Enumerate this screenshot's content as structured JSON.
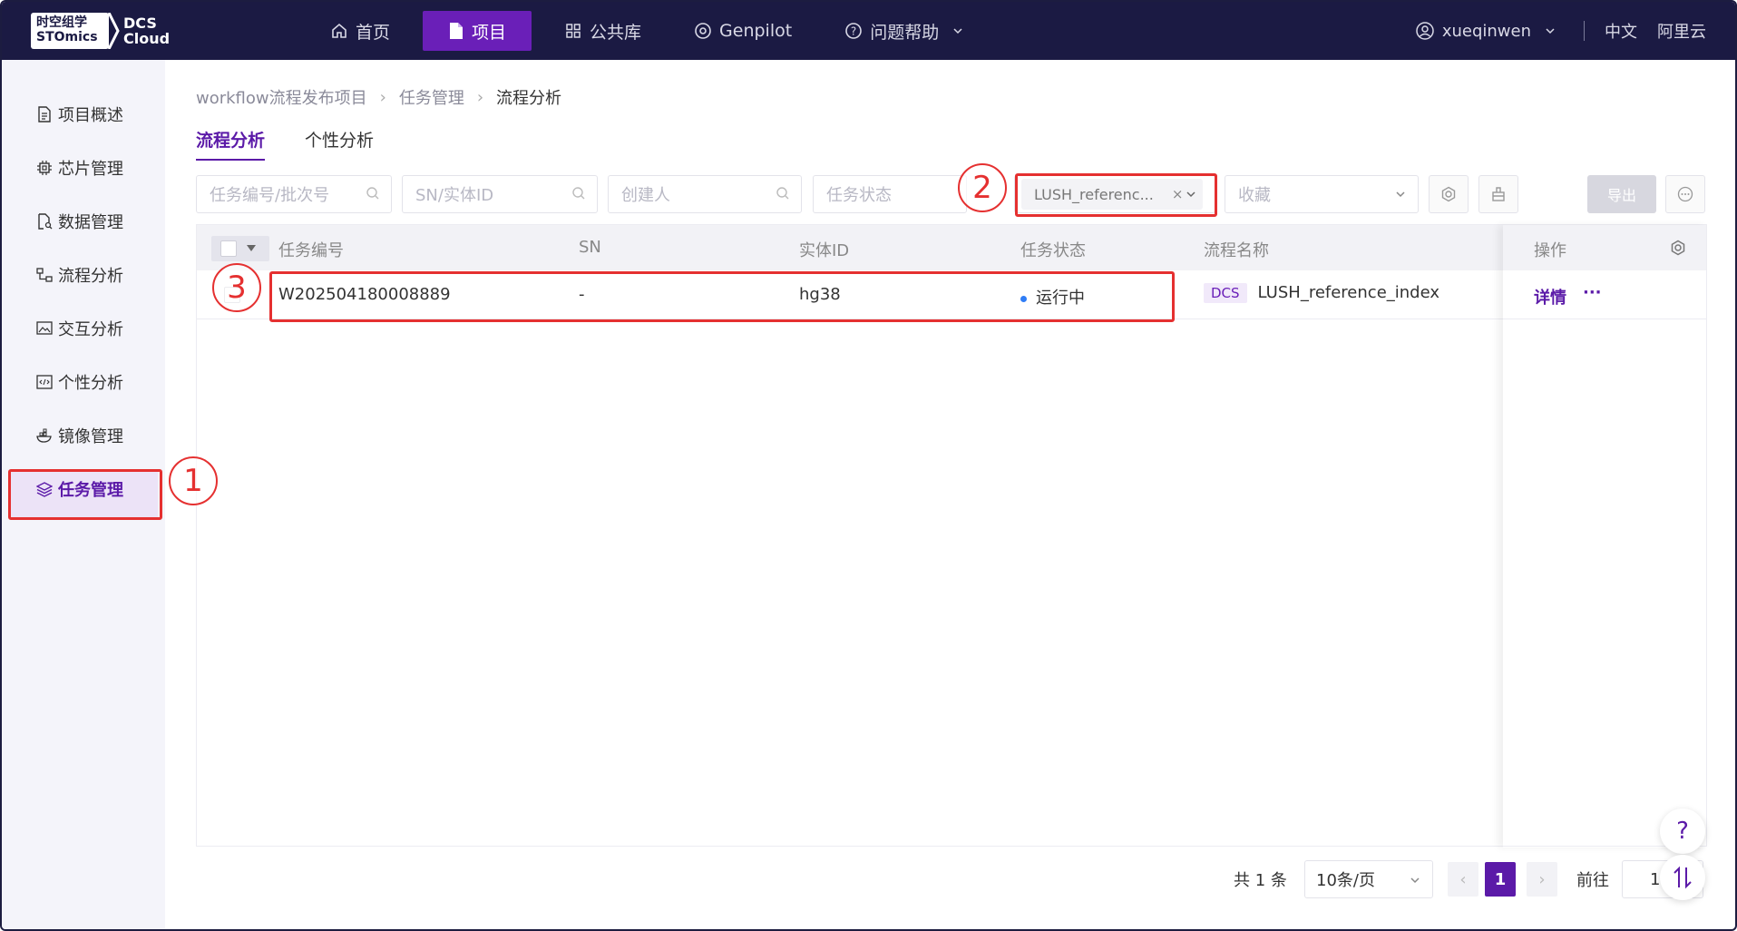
{
  "logo": {
    "brand_line1": "时空组学",
    "brand_line2": "STOmics",
    "product_line1": "DCS",
    "product_line2": "Cloud"
  },
  "nav": {
    "home": "首页",
    "project": "项目",
    "library": "公共库",
    "genpilot": "Genpilot",
    "help": "问题帮助"
  },
  "user": {
    "name": "xueqinwen",
    "lang": "中文",
    "region": "阿里云"
  },
  "sidebar": {
    "items": [
      "项目概述",
      "芯片管理",
      "数据管理",
      "流程分析",
      "交互分析",
      "个性分析",
      "镜像管理",
      "任务管理"
    ]
  },
  "breadcrumb": [
    "workflow流程发布项目",
    "任务管理",
    "流程分析"
  ],
  "tabs": [
    "流程分析",
    "个性分析"
  ],
  "filters": {
    "task_no_placeholder": "任务编号/批次号",
    "sn_placeholder": "SN/实体ID",
    "creator_placeholder": "创建人",
    "status_placeholder": "任务状态",
    "workflow_chip": "LUSH_referenc...",
    "favorite_placeholder": "收藏",
    "export_label": "导出"
  },
  "table": {
    "headers": [
      "任务编号",
      "SN",
      "实体ID",
      "任务状态",
      "流程名称",
      "操作"
    ],
    "rows": [
      {
        "task_no": "W202504180008889",
        "sn": "-",
        "entity_id": "hg38",
        "status": "运行中",
        "tag": "DCS",
        "workflow": "LUSH_reference_index",
        "action": "详情",
        "more": "···"
      }
    ]
  },
  "pagination": {
    "total": "共 1 条",
    "page_size": "10条/页",
    "current": "1",
    "goto_label": "前往",
    "goto_value": "1"
  },
  "annotations": [
    "1",
    "2",
    "3"
  ],
  "colors": {
    "accent": "#5b1aa8",
    "topbar": "#1b1a43",
    "annotation": "#e53030",
    "status_running": "#2f7df6"
  }
}
